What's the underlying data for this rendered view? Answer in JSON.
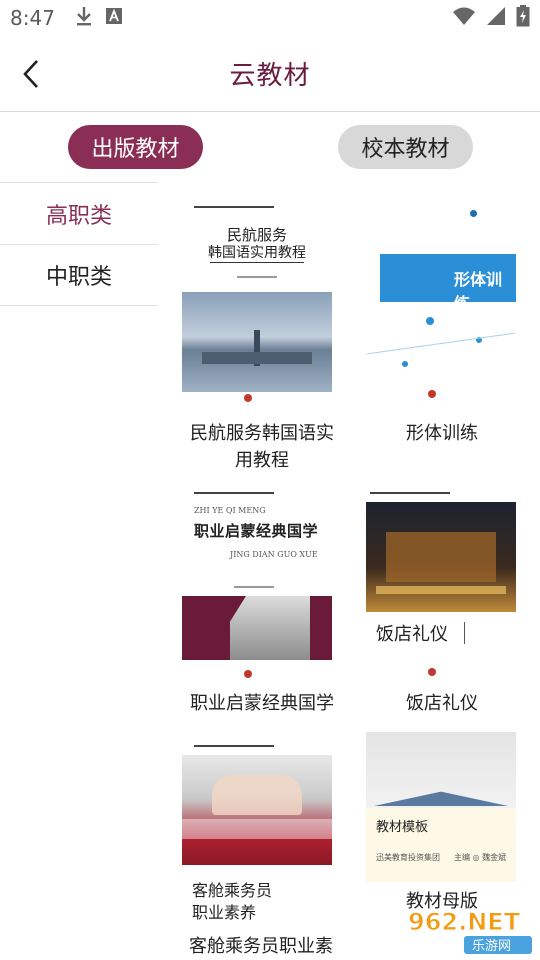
{
  "status": {
    "time": "8:47"
  },
  "header": {
    "title": "云教材"
  },
  "tabs": [
    {
      "label": "出版教材",
      "active": true
    },
    {
      "label": "校本教材",
      "active": false
    }
  ],
  "sidebar": {
    "items": [
      {
        "label": "高职类",
        "active": true
      },
      {
        "label": "中职类",
        "active": false
      }
    ]
  },
  "books": [
    {
      "title": "民航服务韩国语实用教程",
      "cover_title_line1": "民航服务",
      "cover_title_line2": "韩国语实用教程"
    },
    {
      "title": "形体训练",
      "cover_title": "形体训练"
    },
    {
      "title": "职业启蒙经典国学",
      "cover_title": "职业启蒙经典国学",
      "cover_pinyin_top": "ZHI YE QI MENG",
      "cover_pinyin_bottom": "JING DIAN GUO XUE"
    },
    {
      "title": "饭店礼仪",
      "cover_title": "饭店礼仪"
    },
    {
      "title": "客舱乘务员职业素",
      "cover_title_line1": "客舱乘务员",
      "cover_title_line2": "职业素养"
    },
    {
      "title": "教材母版",
      "cover_title": "教材模板",
      "cover_publisher": "迅美教育投资集团",
      "cover_editor": "主编 ◎ 魏金斌"
    }
  ],
  "watermark": {
    "text": "962.NET",
    "subtext": "乐游网"
  },
  "colors": {
    "accent": "#8a2e56",
    "header_title": "#6a1d3e",
    "tab_inactive": "#d8d8d8"
  },
  "icons": [
    "back-arrow-icon",
    "download-icon",
    "font-app-icon",
    "wifi-icon",
    "signal-icon",
    "battery-icon"
  ]
}
